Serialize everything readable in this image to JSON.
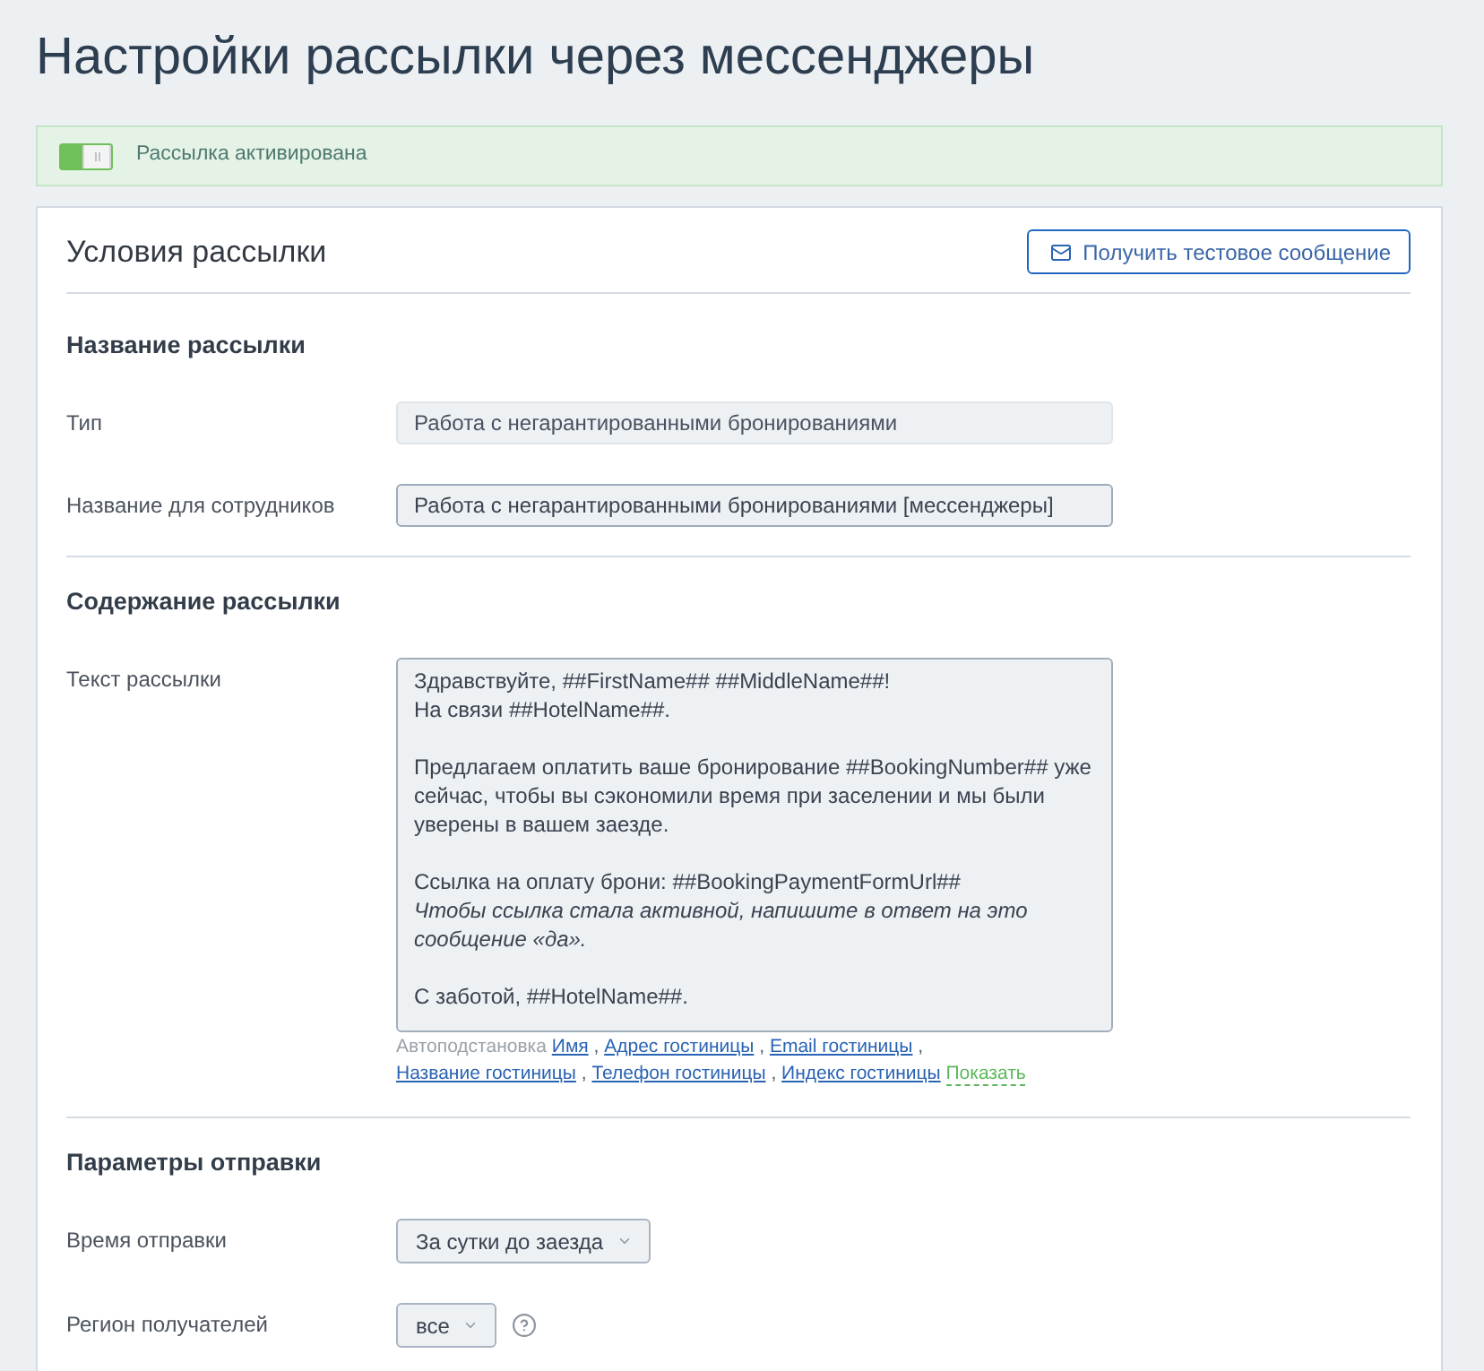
{
  "page": {
    "title": "Настройки рассылки через мессенджеры"
  },
  "activation": {
    "on": true,
    "label": "Рассылка активирована"
  },
  "card": {
    "title": "Условия рассылки",
    "test_button": "Получить тестовое сообщение"
  },
  "sections": [
    {
      "title": "Название рассылки",
      "rows": [
        {
          "kind": "text",
          "label": "Тип",
          "value": "Работа с негарантированными бронированиями",
          "disabled": true
        },
        {
          "kind": "text",
          "label": "Название для сотрудников",
          "value": "Работа с негарантированными бронированиями [мессенджеры]",
          "disabled": false
        }
      ]
    },
    {
      "title": "Содержание рассылки",
      "rows": [
        {
          "kind": "textarea",
          "label": "Текст рассылки",
          "disabled": false,
          "paragraphs": [
            [
              "Здравствуйте, ##FirstName## ##MiddleName##!",
              "На связи ##HotelName##."
            ],
            [
              "Предлагаем оплатить ваше бронирование ##BookingNumber## уже сейчас, чтобы вы сэкономили время при заселении и мы были уверены в вашем заезде."
            ],
            [
              "Ссылка на оплату брони: ##BookingPaymentFormUrl##",
              "*Чтобы ссылка стала активной, напишите в ответ на это сообщение «да».*"
            ],
            [
              "С заботой, ##HotelName##."
            ]
          ],
          "autofill": {
            "label": "Автоподстановка",
            "separator": ",",
            "links": [
              "Имя",
              "Адрес гостиницы",
              "Email гостиницы",
              "Название гостиницы",
              "Телефон гостиницы",
              "Индекс гостиницы"
            ],
            "toggle": "Показать"
          }
        }
      ]
    },
    {
      "title": "Параметры отправки",
      "rows": [
        {
          "kind": "select",
          "label": "Время отправки",
          "value": "За сутки до заезда",
          "disabled": false
        },
        {
          "kind": "select",
          "label": "Регион получателей",
          "value": "все",
          "disabled": false,
          "help": true
        }
      ]
    }
  ]
}
